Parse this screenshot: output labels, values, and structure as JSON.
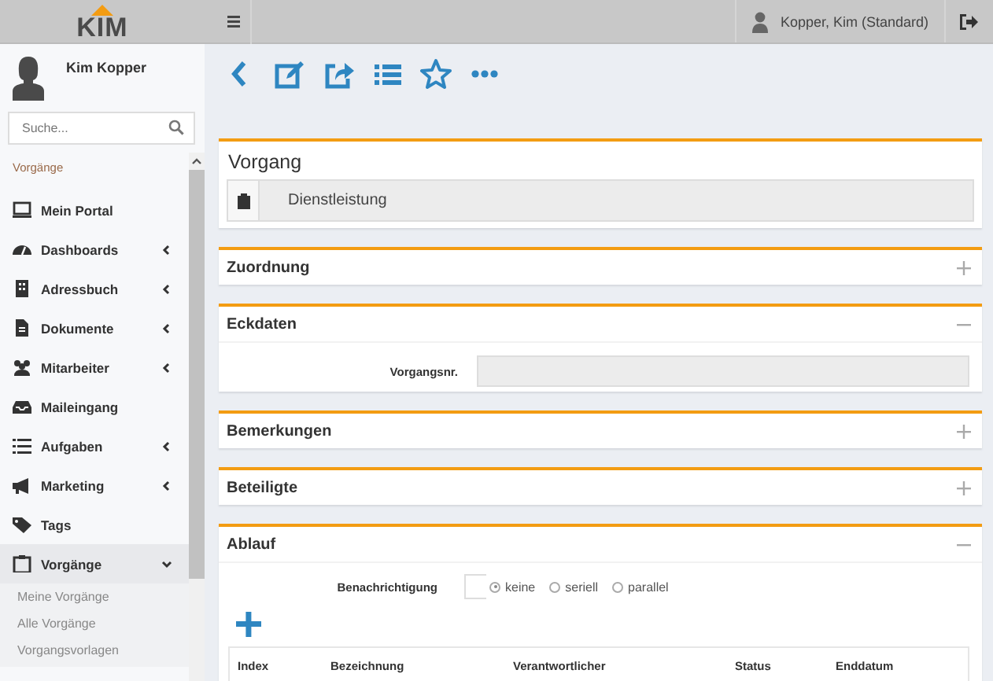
{
  "header": {
    "logo": "KIM",
    "user": "Kopper, Kim (Standard)"
  },
  "sidebar": {
    "user_name": "Kim Kopper",
    "search": {
      "placeholder": "Suche..."
    },
    "section_label": "Vorgänge",
    "items": [
      {
        "label": "Mein Portal",
        "selected": false
      },
      {
        "label": "Dashboards",
        "expanded": false,
        "selected": false
      },
      {
        "label": "Adressbuch",
        "expanded": false,
        "selected": false
      },
      {
        "label": "Dokumente",
        "expanded": false,
        "selected": false
      },
      {
        "label": "Mitarbeiter",
        "expanded": false,
        "selected": false
      },
      {
        "label": "Maileingang",
        "selected": false
      },
      {
        "label": "Aufgaben",
        "expanded": false,
        "selected": false
      },
      {
        "label": "Marketing",
        "expanded": false,
        "selected": false
      },
      {
        "label": "Tags",
        "selected": false
      },
      {
        "label": "Vorgänge",
        "expanded": true,
        "selected": true,
        "children": [
          {
            "label": "Meine Vorgänge"
          },
          {
            "label": "Alle Vorgänge"
          },
          {
            "label": "Vorgangsvorlagen"
          }
        ]
      }
    ]
  },
  "vorgang": {
    "title": "Vorgang",
    "type": "Dienstleistung"
  },
  "sections": [
    {
      "title": "Zuordnung",
      "expanded": false
    },
    {
      "kind": "fields",
      "title": "Eckdaten",
      "expanded": true,
      "fields": [
        {
          "label": "Vorgangsnr."
        }
      ]
    },
    {
      "title": "Bemerkungen",
      "expanded": false
    },
    {
      "title": "Beteiligte",
      "expanded": false
    },
    {
      "kind": "flow",
      "title": "Ablauf",
      "expanded": true,
      "notification": {
        "label": "Benachrichtigung",
        "options": [
          {
            "label": "keine",
            "selected": true
          },
          {
            "label": "seriell",
            "selected": false
          },
          {
            "label": "parallel",
            "selected": false
          }
        ]
      },
      "columns": [
        "Index",
        "Bezeichnung",
        "Verantwortlicher",
        "Status",
        "Enddatum"
      ]
    }
  ]
}
